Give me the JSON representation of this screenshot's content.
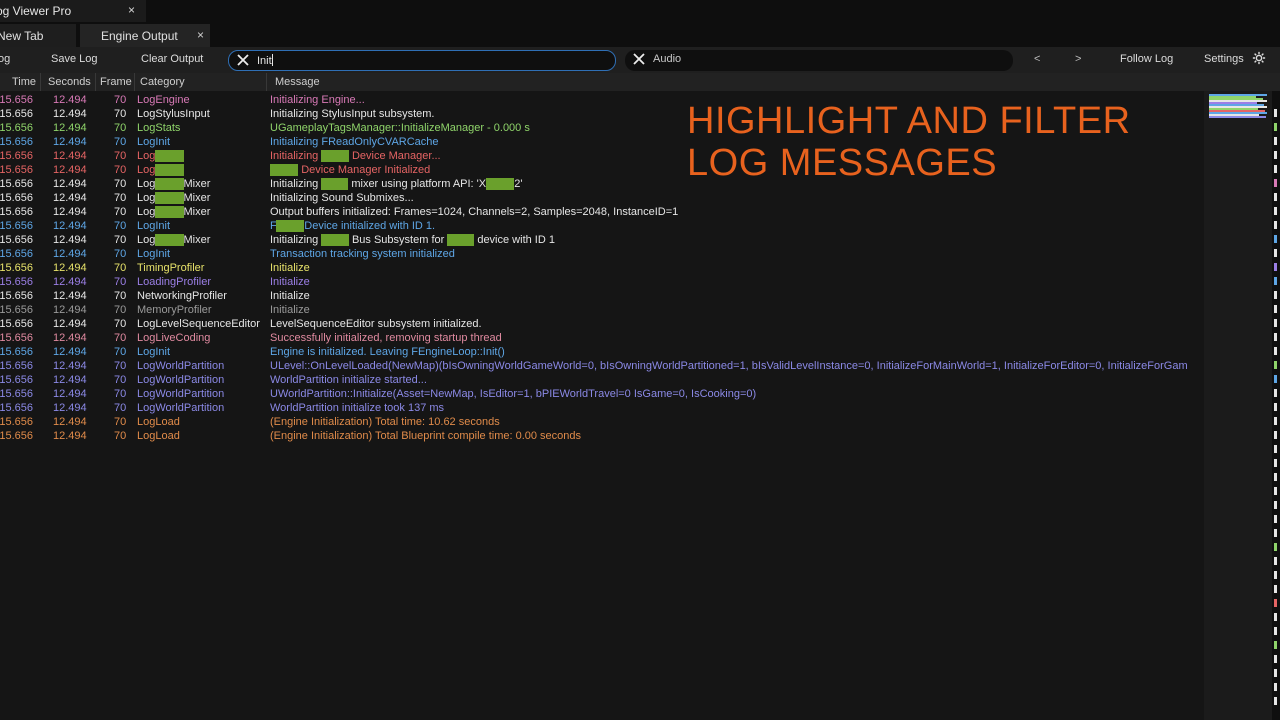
{
  "app": {
    "title": "og Viewer Pro",
    "close_glyph": "×"
  },
  "tabs": [
    {
      "label": "New Tab",
      "active": false
    },
    {
      "label": "Engine Output",
      "active": true,
      "close_glyph": "×"
    }
  ],
  "toolbar": {
    "left_fragment": "og",
    "save_log": "Save Log",
    "clear_output": "Clear Output",
    "search_value": "Init",
    "highlight_value": "Audio",
    "prev_glyph": "<",
    "next_glyph": ">",
    "follow_log": "Follow Log",
    "settings": "Settings",
    "settings_icon": "gear-icon",
    "clear_icon": "close-icon"
  },
  "columns": {
    "time": "Time",
    "seconds": "Seconds",
    "frame": "Frame",
    "category": "Category",
    "message": "Message"
  },
  "overlay": {
    "line1": "HIGHLIGHT AND FILTER",
    "line2": "LOG MESSAGES"
  },
  "colors": {
    "pink": "#d879b6",
    "white": "#e6e6e6",
    "green": "#8fd46a",
    "blue": "#5ea6e6",
    "red": "#e56464",
    "yellow": "#e7e26a",
    "purple": "#9b7fe6",
    "gray": "#9a9a9a",
    "rose": "#e08aa0",
    "lilac": "#8b89e6",
    "orange": "#e08b4a",
    "highlight": "#6aa02c",
    "accent": "#e8621e"
  },
  "log": [
    {
      "time": "15.656",
      "seconds": "12.494",
      "frame": "70",
      "category": "LogEngine",
      "message": "Initializing Engine...",
      "color": "pink"
    },
    {
      "time": "15.656",
      "seconds": "12.494",
      "frame": "70",
      "category": "LogStylusInput",
      "message": "Initializing StylusInput subsystem.",
      "color": "white"
    },
    {
      "time": "15.656",
      "seconds": "12.494",
      "frame": "70",
      "category": "LogStats",
      "message": "UGameplayTagsManager::InitializeManager -  0.000 s",
      "color": "green"
    },
    {
      "time": "15.656",
      "seconds": "12.494",
      "frame": "70",
      "category": "LogInit",
      "message": "Initializing FReadOnlyCVARCache",
      "color": "blue"
    },
    {
      "time": "15.656",
      "seconds": "12.494",
      "frame": "70",
      "category": "LogAudio",
      "message": "Initializing Audio Device Manager...",
      "color": "red"
    },
    {
      "time": "15.656",
      "seconds": "12.494",
      "frame": "70",
      "category": "LogAudio",
      "message": "Audio Device Manager Initialized",
      "color": "red"
    },
    {
      "time": "15.656",
      "seconds": "12.494",
      "frame": "70",
      "category": "LogAudioMixer",
      "message": "Initializing audio mixer using platform API: 'XAudio2'",
      "color": "white"
    },
    {
      "time": "15.656",
      "seconds": "12.494",
      "frame": "70",
      "category": "LogAudioMixer",
      "message": "Initializing Sound Submixes...",
      "color": "white"
    },
    {
      "time": "15.656",
      "seconds": "12.494",
      "frame": "70",
      "category": "LogAudioMixer",
      "message": "Output buffers initialized: Frames=1024, Channels=2, Samples=2048, InstanceID=1",
      "color": "white"
    },
    {
      "time": "15.656",
      "seconds": "12.494",
      "frame": "70",
      "category": "LogInit",
      "message": "FAudioDevice initialized with ID 1.",
      "color": "blue"
    },
    {
      "time": "15.656",
      "seconds": "12.494",
      "frame": "70",
      "category": "LogAudioMixer",
      "message": "Initializing Audio Bus Subsystem for audio device with ID 1",
      "color": "white"
    },
    {
      "time": "15.656",
      "seconds": "12.494",
      "frame": "70",
      "category": "LogInit",
      "message": "Transaction tracking system initialized",
      "color": "blue"
    },
    {
      "time": "15.656",
      "seconds": "12.494",
      "frame": "70",
      "category": "TimingProfiler",
      "message": "Initialize",
      "color": "yellow"
    },
    {
      "time": "15.656",
      "seconds": "12.494",
      "frame": "70",
      "category": "LoadingProfiler",
      "message": "Initialize",
      "color": "purple"
    },
    {
      "time": "15.656",
      "seconds": "12.494",
      "frame": "70",
      "category": "NetworkingProfiler",
      "message": "Initialize",
      "color": "white"
    },
    {
      "time": "15.656",
      "seconds": "12.494",
      "frame": "70",
      "category": "MemoryProfiler",
      "message": "Initialize",
      "color": "gray"
    },
    {
      "time": "15.656",
      "seconds": "12.494",
      "frame": "70",
      "category": "LogLevelSequenceEditor",
      "message": "LevelSequenceEditor subsystem initialized.",
      "color": "white"
    },
    {
      "time": "15.656",
      "seconds": "12.494",
      "frame": "70",
      "category": "LogLiveCoding",
      "message": "Successfully initialized, removing startup thread",
      "color": "rose"
    },
    {
      "time": "15.656",
      "seconds": "12.494",
      "frame": "70",
      "category": "LogInit",
      "message": "Engine is initialized. Leaving FEngineLoop::Init()",
      "color": "blue"
    },
    {
      "time": "15.656",
      "seconds": "12.494",
      "frame": "70",
      "category": "LogWorldPartition",
      "message": "ULevel::OnLevelLoaded(NewMap)(bIsOwningWorldGameWorld=0, bIsOwningWorldPartitioned=1, bIsValidLevelInstance=0, InitializeForMainWorld=1, InitializeForEditor=0, InitializeForGam",
      "color": "lilac"
    },
    {
      "time": "15.656",
      "seconds": "12.494",
      "frame": "70",
      "category": "LogWorldPartition",
      "message": "WorldPartition initialize started...",
      "color": "lilac"
    },
    {
      "time": "15.656",
      "seconds": "12.494",
      "frame": "70",
      "category": "LogWorldPartition",
      "message": "UWorldPartition::Initialize(Asset=NewMap, IsEditor=1, bPIEWorldTravel=0 IsGame=0, IsCooking=0)",
      "color": "lilac"
    },
    {
      "time": "15.656",
      "seconds": "12.494",
      "frame": "70",
      "category": "LogWorldPartition",
      "message": "WorldPartition initialize took 137 ms",
      "color": "lilac"
    },
    {
      "time": "15.656",
      "seconds": "12.494",
      "frame": "70",
      "category": "LogLoad",
      "message": "(Engine Initialization) Total time: 10.62 seconds",
      "color": "orange"
    },
    {
      "time": "15.656",
      "seconds": "12.494",
      "frame": "70",
      "category": "LogLoad",
      "message": "(Engine Initialization) Total Blueprint compile time: 0.00 seconds",
      "color": "orange"
    }
  ]
}
